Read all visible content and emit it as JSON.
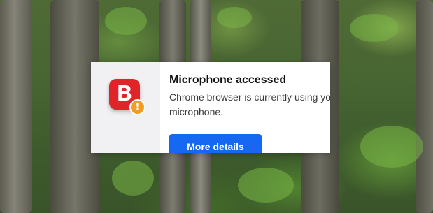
{
  "notification": {
    "app_icon": "bitdefender-b-logo-icon",
    "app_icon_letter": "B",
    "badge_icon": "warning-exclamation-icon",
    "badge_symbol": "!",
    "title": "Microphone accessed",
    "message_line1": "Chrome browser is currently using yo",
    "message_line2": "microphone.",
    "action_label": "More details"
  },
  "colors": {
    "app_icon_background": "#e0252a",
    "badge_background": "#f39c1f",
    "button_background": "#1668f2",
    "side_panel_background": "#f1f1f4"
  },
  "desktop": {
    "wallpaper": "forest-wallpaper"
  }
}
